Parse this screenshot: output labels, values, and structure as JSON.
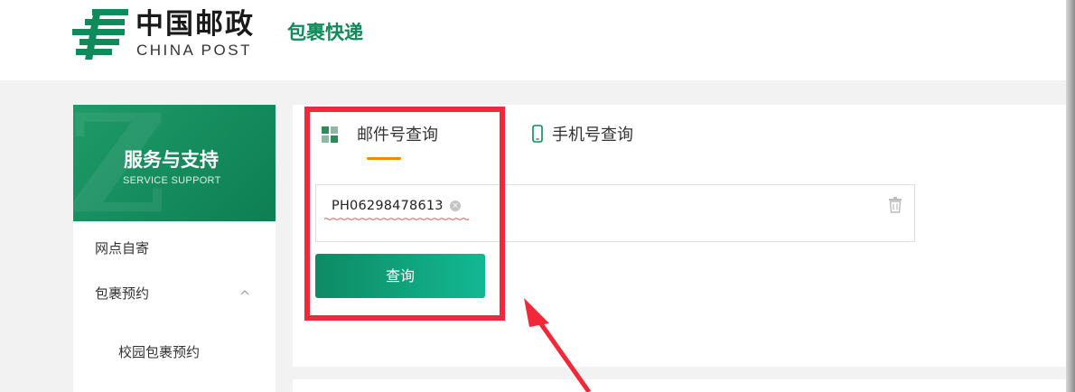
{
  "header": {
    "logo_cn": "中国邮政",
    "logo_en": "CHINA POST",
    "service_name": "包裹快递"
  },
  "sidebar": {
    "banner_title": "服务与支持",
    "banner_subtitle": "SERVICE SUPPORT",
    "banner_deco": "Z",
    "items": [
      {
        "label": "网点自寄"
      },
      {
        "label": "包裹预约",
        "expanded": true
      },
      {
        "label": "校园包裹预约"
      }
    ]
  },
  "query": {
    "tabs": [
      {
        "label": "邮件号查询",
        "icon": "grid-icon",
        "active": true
      },
      {
        "label": "手机号查询",
        "icon": "phone-icon",
        "active": false
      }
    ],
    "tracking_number": "PH06298478613",
    "button_label": "查询"
  },
  "colors": {
    "brand_green": "#0f8a5a",
    "tab_accent": "#f08a00",
    "annotation_red": "#f0283a"
  }
}
